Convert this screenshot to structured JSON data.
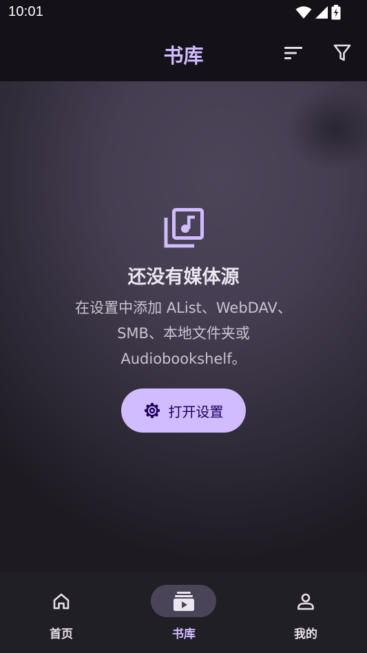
{
  "status_bar": {
    "time": "10:01",
    "icons": [
      "wifi-icon",
      "signal-icon",
      "battery-charging-icon"
    ]
  },
  "app_bar": {
    "title": "书库",
    "actions": [
      "sort-icon",
      "filter-icon"
    ]
  },
  "empty_state": {
    "icon": "music-library-icon",
    "title": "还没有媒体源",
    "description_lines": [
      "在设置中添加 AList、WebDAV、",
      "SMB、本地文件夹或",
      "Audiobookshelf。"
    ],
    "button_label": "打开设置",
    "button_icon": "gear-icon"
  },
  "bottom_nav": {
    "items": [
      {
        "label": "首页",
        "icon": "home-icon",
        "active": false
      },
      {
        "label": "书库",
        "icon": "library-icon",
        "active": true
      },
      {
        "label": "我的",
        "icon": "person-icon",
        "active": false
      }
    ]
  },
  "colors": {
    "background": "#141218",
    "accent": "#d0bcff",
    "accent_on": "#21005d",
    "nav_background": "#211f26",
    "nav_indicator": "#4a4458"
  }
}
